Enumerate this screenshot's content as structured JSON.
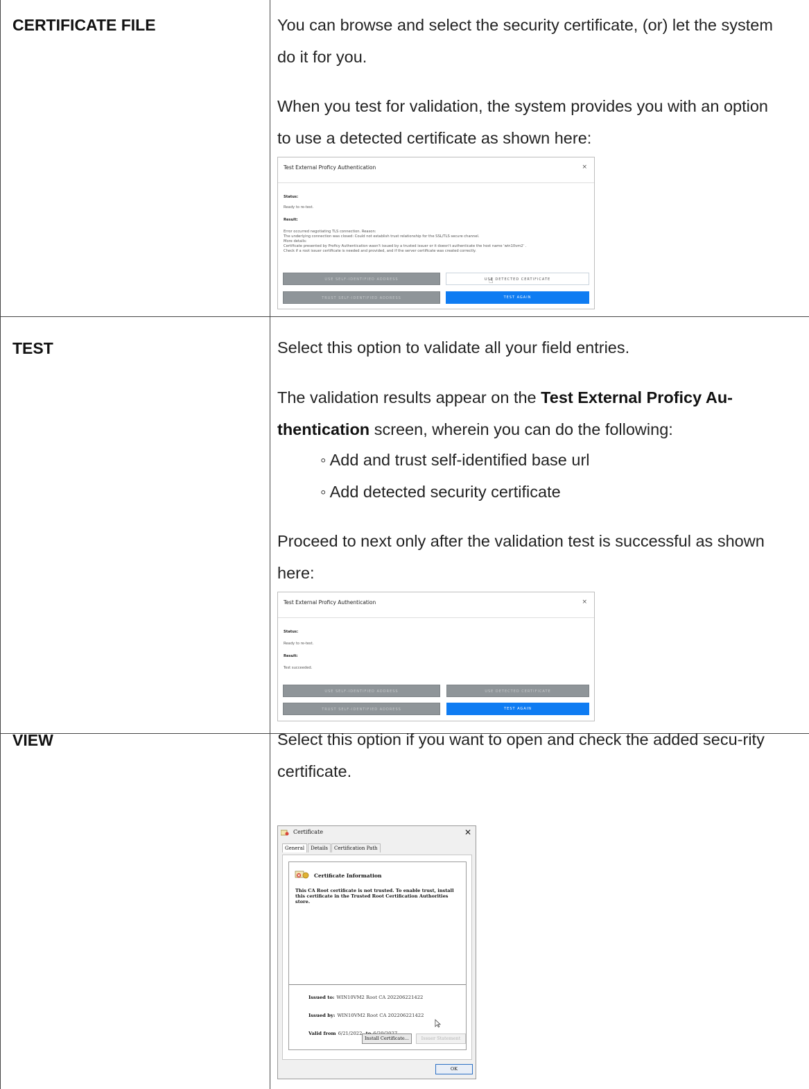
{
  "rows": {
    "certificate_file": {
      "label": "CERTIFICATE FILE",
      "p1": "You can browse and select the security certificate, (or) let the system do it for you.",
      "p2": "When you test for validation, the system provides you with an option to use a detected certificate as shown here:"
    },
    "test": {
      "label": "TEST",
      "p1": "Select this option to validate all your field entries.",
      "p2_pre": "The validation results appear on the ",
      "p2_bold": "Test External Proficy Au-thentication",
      "p2_post": " screen, wherein you can do the following:",
      "bullets": [
        "Add and trust self-identified base url",
        "Add detected security certificate"
      ],
      "p3": "Proceed to next only after the validation test is successful as shown here:"
    },
    "view": {
      "label": "VIEW",
      "p1": "Select this option if you want to open and check the added secu-rity certificate."
    }
  },
  "bullet_glyph": "◦",
  "dialog1": {
    "title": "Test External Proficy Authentication",
    "close": "×",
    "status_label": "Status:",
    "status_value": "Ready to re-test.",
    "result_label": "Result:",
    "result_lines": [
      "Error occurred negotiating TLS connection. Reason:",
      "The underlying connection was closed: Could not establish trust relationship for the SSL/TLS secure channel.",
      "More details:",
      "Certificate presented by Proficy Authentication wasn't issued by a trusted issuer or it doesn't authenticate the host name 'win10vm2' .",
      "Check if a root issuer certificate is needed and provided, and if the server certificate was created correctly."
    ],
    "btn_use_address": "USE SELF-IDENTIFIED ADDRESS",
    "btn_use_cert": "USE DETECTED CERTIFICATE",
    "btn_trust_address": "TRUST SELF-IDENTIFIED ADDRESS",
    "btn_test_again": "TEST AGAIN"
  },
  "dialog2": {
    "title": "Test External Proficy Authentication",
    "close": "×",
    "status_label": "Status:",
    "status_value": "Ready to re-test.",
    "result_label": "Result:",
    "result_value": "Test succeeded.",
    "btn_use_address": "USE SELF-IDENTIFIED ADDRESS",
    "btn_use_cert": "USE DETECTED CERTIFICATE",
    "btn_trust_address": "TRUST SELF-IDENTIFIED ADDRESS",
    "btn_test_again": "TEST AGAIN"
  },
  "certificate": {
    "title": "Certificate",
    "close": "✕",
    "tabs": [
      "General",
      "Details",
      "Certification Path"
    ],
    "info_title": "Certificate Information",
    "warning": "This CA Root certificate is not trusted. To enable trust, install this certificate in the Trusted Root Certification Authorities store.",
    "issued_to_label": "Issued to:",
    "issued_to": "WIN10VM2 Root CA 202206221422",
    "issued_by_label": "Issued by:",
    "issued_by": "WIN10VM2 Root CA 202206221422",
    "valid_from_label": "Valid from",
    "valid_from": "6/21/2022",
    "to_label": "to",
    "valid_to": "6/20/2027",
    "install_button": "Install Certificate...",
    "issuer_statement_button": "Issuer Statement",
    "ok_button": "OK"
  }
}
